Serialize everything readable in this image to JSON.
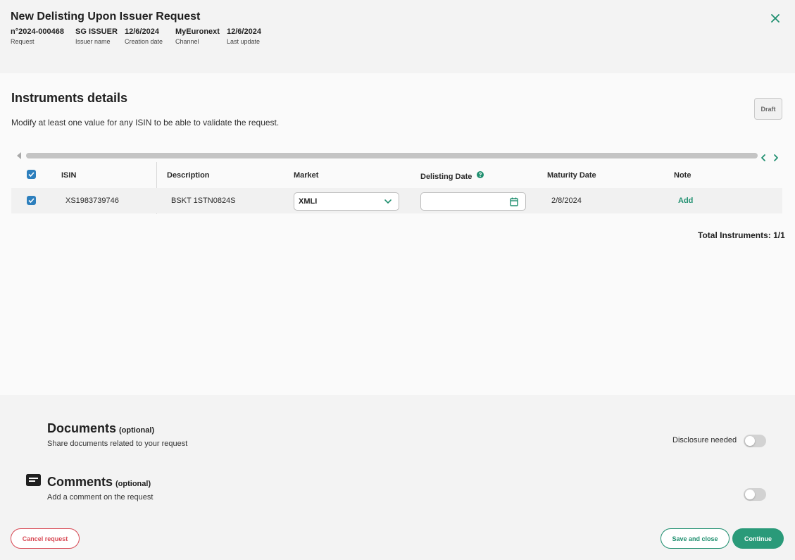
{
  "header": {
    "title": "New Delisting Upon Issuer Request",
    "meta": [
      {
        "value": "n°2024-000468",
        "label": "Request"
      },
      {
        "value": "SG ISSUER",
        "label": "Issuer name"
      },
      {
        "value": "12/6/2024",
        "label": "Creation date"
      },
      {
        "value": "MyEuronext",
        "label": "Channel"
      },
      {
        "value": "12/6/2024",
        "label": "Last update"
      }
    ],
    "close_icon": "close-icon"
  },
  "instruments": {
    "title": "Instruments details",
    "description": "Modify at least one value for any ISIN to be able to validate the request.",
    "status_label": "Draft",
    "columns": {
      "isin": "ISIN",
      "description": "Description",
      "market": "Market",
      "delisting_date": "Delisting Date",
      "maturity_date": "Maturity Date",
      "note": "Note"
    },
    "rows": [
      {
        "selected": true,
        "isin": "XS1983739746",
        "description": "BSKT 1STN0824S",
        "market": "XMLI",
        "delisting_date": "",
        "maturity_date": "2/8/2024",
        "note_action": "Add"
      }
    ],
    "total": "Total Instruments: 1/1"
  },
  "documents": {
    "title": "Documents",
    "optional": "(optional)",
    "description": "Share documents related to your request",
    "disclosure_label": "Disclosure needed",
    "disclosure_on": false
  },
  "comments": {
    "title": "Comments",
    "optional": "(optional)",
    "description": "Add a comment on the request",
    "toggle_on": false
  },
  "footer": {
    "cancel_label": "Cancel request",
    "save_label": "Save and close",
    "continue_label": "Continue"
  },
  "colors": {
    "accent": "#2a9a79",
    "danger": "#d84a55",
    "checkbox": "#2d7fbd"
  }
}
